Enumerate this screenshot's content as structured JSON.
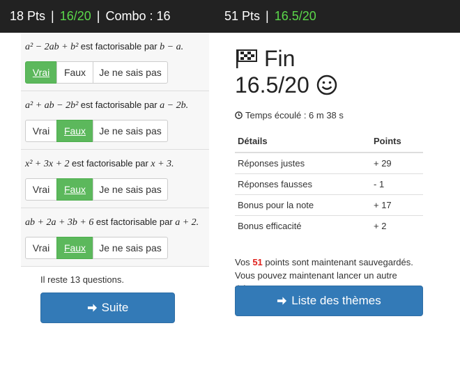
{
  "header": {
    "left_pts": "18 Pts",
    "left_score": "16/20",
    "combo": "Combo : 16",
    "right_pts": "51 Pts",
    "right_score": "16.5/20",
    "separator": "|"
  },
  "questions": [
    {
      "expr": "a² − 2ab + b²",
      "text": "est factorisable par",
      "target": "b − a.",
      "answer": "Vrai"
    },
    {
      "expr": "a² + ab − 2b²",
      "text": "est factorisable par",
      "target": "a − 2b.",
      "answer": "Faux"
    },
    {
      "expr": "x² + 3x + 2",
      "text": "est factorisable par",
      "target": "x + 3.",
      "answer": "Faux"
    },
    {
      "expr": "ab + 2a + 3b + 6",
      "text": "est factorisable par",
      "target": "a + 2.",
      "answer": "Faux"
    }
  ],
  "buttons": {
    "vrai": "Vrai",
    "faux": "Faux",
    "nsp": "Je ne sais pas"
  },
  "remaining": "Il reste 13 questions.",
  "suite_label": "Suite",
  "result": {
    "title": "Fin",
    "score": "16.5/20",
    "time_label": "Temps écoulé : 6 m 38 s",
    "table_headers": [
      "Détails",
      "Points"
    ],
    "rows": [
      {
        "label": "Réponses justes",
        "points": "+ 29"
      },
      {
        "label": "Réponses fausses",
        "points": "- 1"
      },
      {
        "label": "Bonus pour la note",
        "points": "+ 17"
      },
      {
        "label": "Bonus efficacité",
        "points": "+ 2"
      }
    ],
    "note_prefix": "Vos",
    "note_points": "51",
    "note_suffix": "points sont maintenant sauvegardés. Vous pouvez maintenant lancer un autre thème.",
    "themes_label": "Liste des thèmes"
  },
  "colors": {
    "topbar": "#222222",
    "green": "#5cb85c",
    "primary": "#337ab7",
    "highlight_red": "#e0201b"
  },
  "icons": [
    "flag-icon",
    "smiley-icon",
    "clock-icon",
    "arrow-right-icon"
  ]
}
